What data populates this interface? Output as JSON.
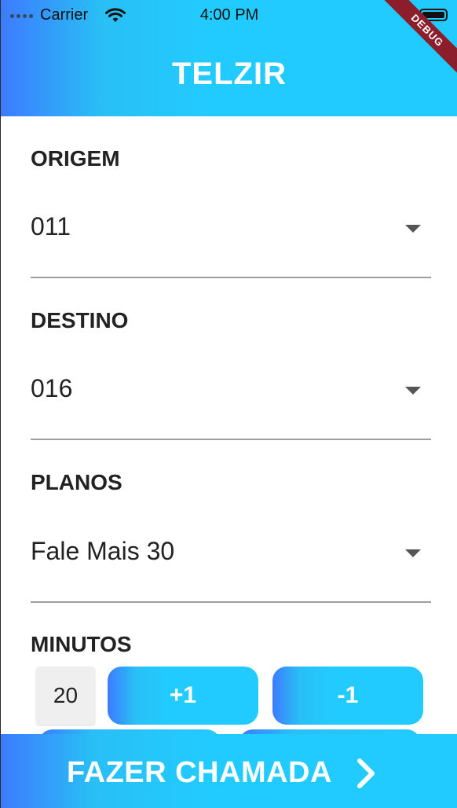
{
  "status_bar": {
    "carrier": "Carrier",
    "time": "4:00 PM",
    "icons": [
      "signal-dots-icon",
      "wifi-icon",
      "battery-icon"
    ]
  },
  "debug_banner": "DEBUG",
  "app_bar": {
    "title": "TELZIR"
  },
  "form": {
    "origem": {
      "label": "ORIGEM",
      "value": "011"
    },
    "destino": {
      "label": "DESTINO",
      "value": "016"
    },
    "planos": {
      "label": "PLANOS",
      "value": "Fale Mais 30"
    },
    "minutos": {
      "label": "MINUTOS",
      "value": "20",
      "plus_label": "+1",
      "minus_label": "-1"
    }
  },
  "call_button": {
    "label": "FAZER CHAMADA",
    "icon": "chevron-right-icon"
  },
  "colors": {
    "accent": "#22cbff",
    "gradient_start": "#3d7bff",
    "debug": "#8c1e2c"
  }
}
